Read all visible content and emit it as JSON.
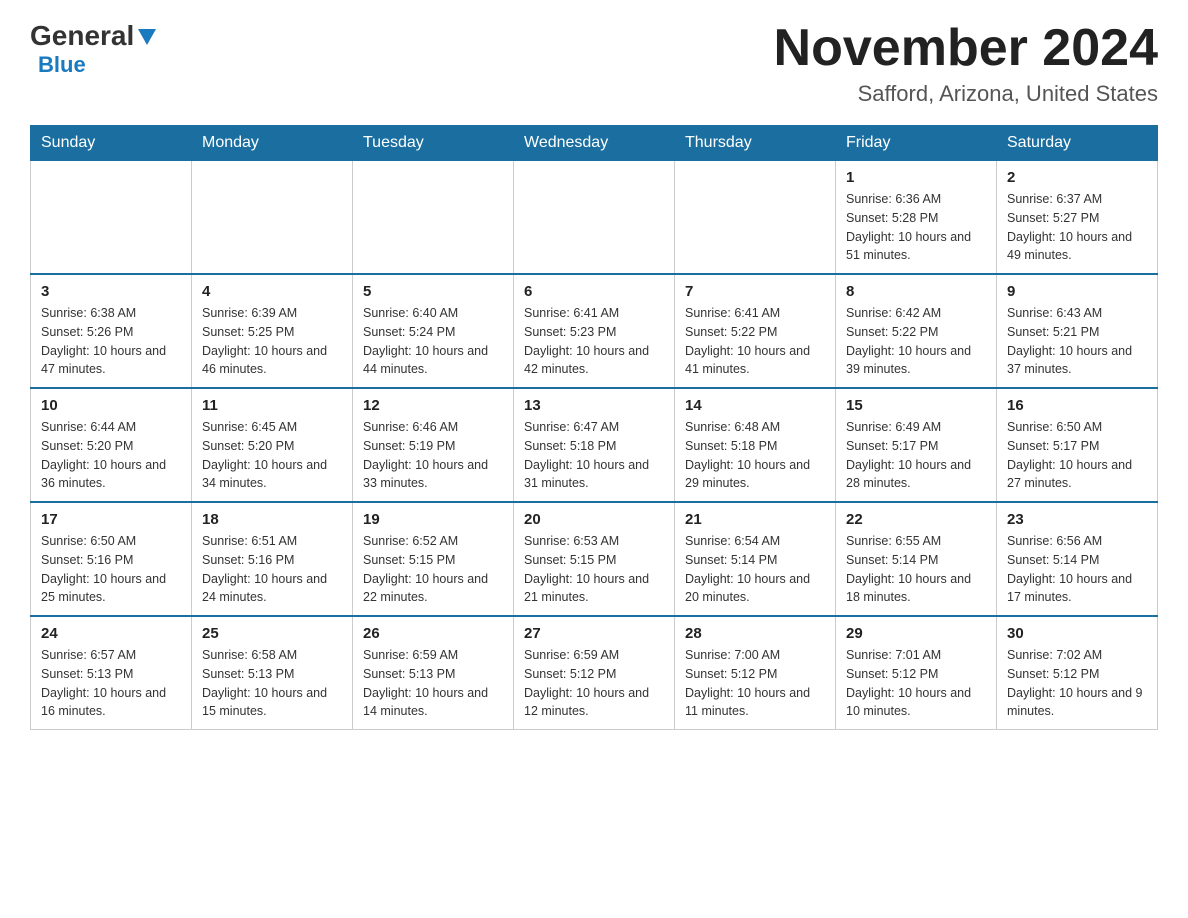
{
  "header": {
    "logo_general": "General",
    "logo_blue": "Blue",
    "month_title": "November 2024",
    "location": "Safford, Arizona, United States"
  },
  "days_of_week": [
    "Sunday",
    "Monday",
    "Tuesday",
    "Wednesday",
    "Thursday",
    "Friday",
    "Saturday"
  ],
  "weeks": [
    {
      "days": [
        {
          "num": "",
          "info": ""
        },
        {
          "num": "",
          "info": ""
        },
        {
          "num": "",
          "info": ""
        },
        {
          "num": "",
          "info": ""
        },
        {
          "num": "",
          "info": ""
        },
        {
          "num": "1",
          "info": "Sunrise: 6:36 AM\nSunset: 5:28 PM\nDaylight: 10 hours and 51 minutes."
        },
        {
          "num": "2",
          "info": "Sunrise: 6:37 AM\nSunset: 5:27 PM\nDaylight: 10 hours and 49 minutes."
        }
      ]
    },
    {
      "days": [
        {
          "num": "3",
          "info": "Sunrise: 6:38 AM\nSunset: 5:26 PM\nDaylight: 10 hours and 47 minutes."
        },
        {
          "num": "4",
          "info": "Sunrise: 6:39 AM\nSunset: 5:25 PM\nDaylight: 10 hours and 46 minutes."
        },
        {
          "num": "5",
          "info": "Sunrise: 6:40 AM\nSunset: 5:24 PM\nDaylight: 10 hours and 44 minutes."
        },
        {
          "num": "6",
          "info": "Sunrise: 6:41 AM\nSunset: 5:23 PM\nDaylight: 10 hours and 42 minutes."
        },
        {
          "num": "7",
          "info": "Sunrise: 6:41 AM\nSunset: 5:22 PM\nDaylight: 10 hours and 41 minutes."
        },
        {
          "num": "8",
          "info": "Sunrise: 6:42 AM\nSunset: 5:22 PM\nDaylight: 10 hours and 39 minutes."
        },
        {
          "num": "9",
          "info": "Sunrise: 6:43 AM\nSunset: 5:21 PM\nDaylight: 10 hours and 37 minutes."
        }
      ]
    },
    {
      "days": [
        {
          "num": "10",
          "info": "Sunrise: 6:44 AM\nSunset: 5:20 PM\nDaylight: 10 hours and 36 minutes."
        },
        {
          "num": "11",
          "info": "Sunrise: 6:45 AM\nSunset: 5:20 PM\nDaylight: 10 hours and 34 minutes."
        },
        {
          "num": "12",
          "info": "Sunrise: 6:46 AM\nSunset: 5:19 PM\nDaylight: 10 hours and 33 minutes."
        },
        {
          "num": "13",
          "info": "Sunrise: 6:47 AM\nSunset: 5:18 PM\nDaylight: 10 hours and 31 minutes."
        },
        {
          "num": "14",
          "info": "Sunrise: 6:48 AM\nSunset: 5:18 PM\nDaylight: 10 hours and 29 minutes."
        },
        {
          "num": "15",
          "info": "Sunrise: 6:49 AM\nSunset: 5:17 PM\nDaylight: 10 hours and 28 minutes."
        },
        {
          "num": "16",
          "info": "Sunrise: 6:50 AM\nSunset: 5:17 PM\nDaylight: 10 hours and 27 minutes."
        }
      ]
    },
    {
      "days": [
        {
          "num": "17",
          "info": "Sunrise: 6:50 AM\nSunset: 5:16 PM\nDaylight: 10 hours and 25 minutes."
        },
        {
          "num": "18",
          "info": "Sunrise: 6:51 AM\nSunset: 5:16 PM\nDaylight: 10 hours and 24 minutes."
        },
        {
          "num": "19",
          "info": "Sunrise: 6:52 AM\nSunset: 5:15 PM\nDaylight: 10 hours and 22 minutes."
        },
        {
          "num": "20",
          "info": "Sunrise: 6:53 AM\nSunset: 5:15 PM\nDaylight: 10 hours and 21 minutes."
        },
        {
          "num": "21",
          "info": "Sunrise: 6:54 AM\nSunset: 5:14 PM\nDaylight: 10 hours and 20 minutes."
        },
        {
          "num": "22",
          "info": "Sunrise: 6:55 AM\nSunset: 5:14 PM\nDaylight: 10 hours and 18 minutes."
        },
        {
          "num": "23",
          "info": "Sunrise: 6:56 AM\nSunset: 5:14 PM\nDaylight: 10 hours and 17 minutes."
        }
      ]
    },
    {
      "days": [
        {
          "num": "24",
          "info": "Sunrise: 6:57 AM\nSunset: 5:13 PM\nDaylight: 10 hours and 16 minutes."
        },
        {
          "num": "25",
          "info": "Sunrise: 6:58 AM\nSunset: 5:13 PM\nDaylight: 10 hours and 15 minutes."
        },
        {
          "num": "26",
          "info": "Sunrise: 6:59 AM\nSunset: 5:13 PM\nDaylight: 10 hours and 14 minutes."
        },
        {
          "num": "27",
          "info": "Sunrise: 6:59 AM\nSunset: 5:12 PM\nDaylight: 10 hours and 12 minutes."
        },
        {
          "num": "28",
          "info": "Sunrise: 7:00 AM\nSunset: 5:12 PM\nDaylight: 10 hours and 11 minutes."
        },
        {
          "num": "29",
          "info": "Sunrise: 7:01 AM\nSunset: 5:12 PM\nDaylight: 10 hours and 10 minutes."
        },
        {
          "num": "30",
          "info": "Sunrise: 7:02 AM\nSunset: 5:12 PM\nDaylight: 10 hours and 9 minutes."
        }
      ]
    }
  ]
}
